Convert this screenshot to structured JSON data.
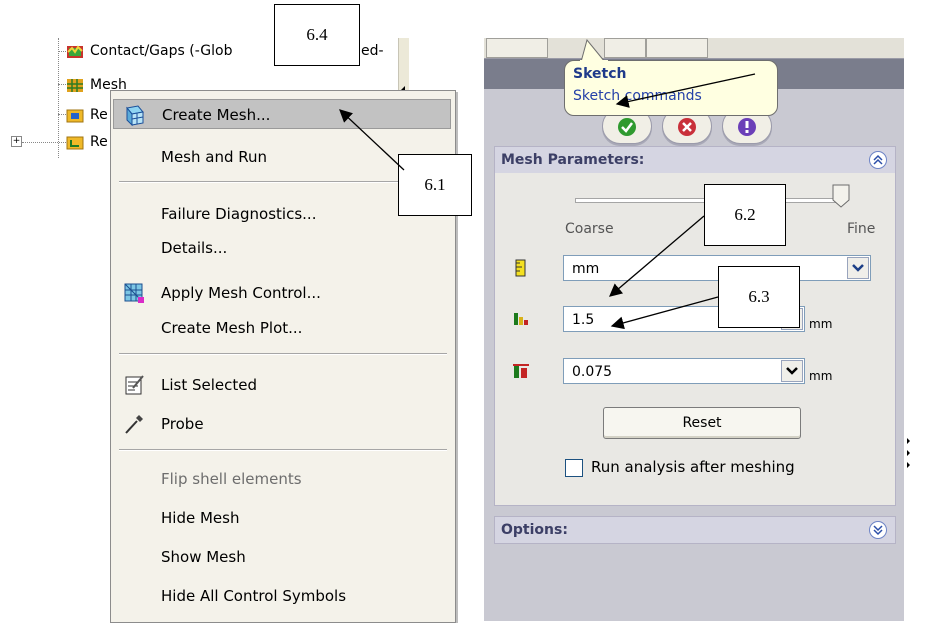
{
  "tree": {
    "items": [
      {
        "label": "Contact/Gaps (-Glob",
        "suffix": "ed-",
        "icon": "contact-gaps-icon"
      },
      {
        "label": "Mesh",
        "icon": "mesh-icon"
      },
      {
        "label": "Re",
        "icon": "result-folder-icon"
      },
      {
        "label": "Re",
        "icon": "report-folder-icon",
        "expander": "+"
      }
    ]
  },
  "context_menu": {
    "items": [
      {
        "label": "Create Mesh...",
        "icon": "create-mesh-icon",
        "highlighted": true
      },
      {
        "label": "Mesh and Run"
      },
      {
        "label": "Failure Diagnostics..."
      },
      {
        "label": "Details..."
      },
      {
        "label": "Apply Mesh Control...",
        "icon": "mesh-control-icon"
      },
      {
        "label": "Create Mesh Plot..."
      },
      {
        "label": "List Selected",
        "icon": "list-selected-icon"
      },
      {
        "label": "Probe",
        "icon": "probe-icon"
      },
      {
        "label": "Flip shell elements",
        "disabled": true
      },
      {
        "label": "Hide Mesh"
      },
      {
        "label": "Show Mesh"
      },
      {
        "label": "Hide All Control Symbols"
      }
    ]
  },
  "property_manager": {
    "tooltip": {
      "title": "Sketch",
      "text": "Sketch commands"
    },
    "buttons": {
      "ok": "checkmark-icon",
      "cancel": "cancel-x-icon",
      "help": "help-icon"
    },
    "mesh_parameters": {
      "title": "Mesh Parameters:",
      "slider_min_label": "Coarse",
      "slider_max_label": "Fine",
      "slider_position": 1.0,
      "unit_select": "mm",
      "global_size": "1.5",
      "global_size_unit": "mm",
      "tolerance": "0.075",
      "tolerance_unit": "mm",
      "reset_label": "Reset",
      "run_after_label": "Run analysis after meshing",
      "run_after_checked": false
    },
    "options": {
      "title": "Options:"
    }
  },
  "annotations": [
    "6.4",
    "6.1",
    "6.2",
    "6.3"
  ],
  "colors": {
    "tooltip_bg": "#ffffe1",
    "menu_highlight": "#c2c2c2",
    "group_title": "#3c3f66",
    "panel_bg": "#c9c9d2"
  }
}
